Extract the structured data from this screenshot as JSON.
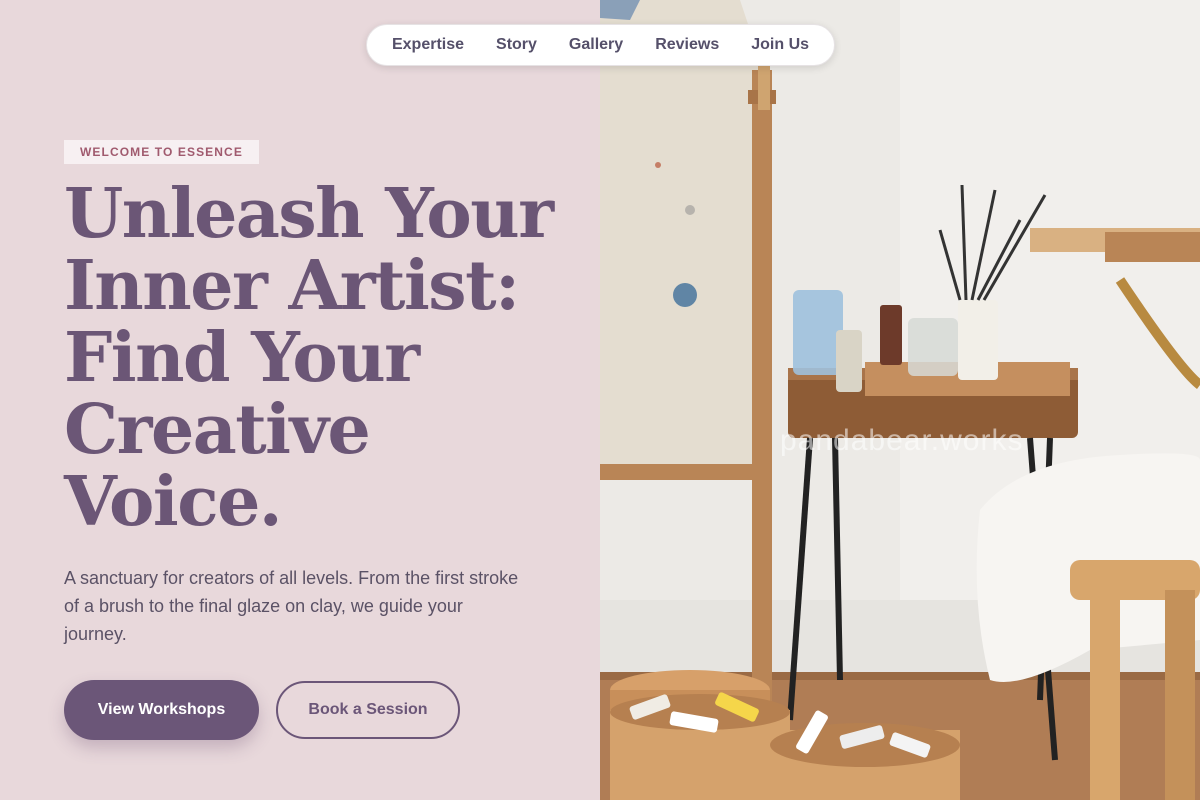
{
  "nav": {
    "items": [
      "Expertise",
      "Story",
      "Gallery",
      "Reviews",
      "Join Us"
    ]
  },
  "hero": {
    "eyebrow": "WELCOME TO ESSENCE",
    "headline": "Unleash Your Inner Artist: Find Your Creative Voice.",
    "lede": "A sanctuary for creators of all levels. From the first stroke of a brush to the final glaze on clay, we guide your journey.",
    "primary_button": "View Workshops",
    "secondary_button": "Book a Session"
  },
  "image": {
    "watermark": "pandabear.works"
  },
  "colors": {
    "background_left": "#e8d8db",
    "accent": "#6b5678",
    "eyebrow_text": "#a05a6e"
  }
}
